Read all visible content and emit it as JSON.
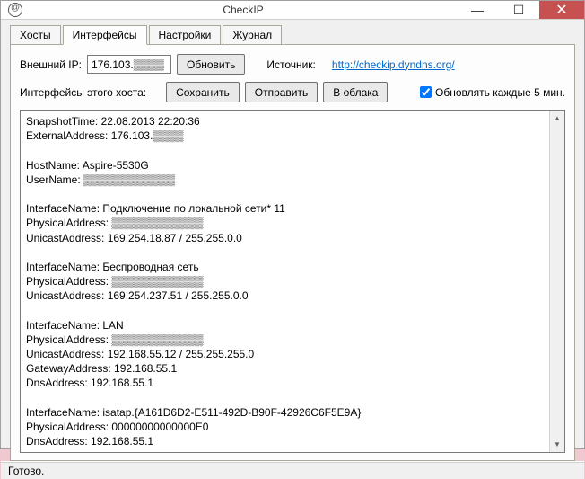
{
  "window": {
    "title": "CheckIP"
  },
  "tabs": {
    "items": [
      {
        "label": "Хосты"
      },
      {
        "label": "Интерфейсы"
      },
      {
        "label": "Настройки"
      },
      {
        "label": "Журнал"
      }
    ],
    "activeIndex": 1
  },
  "row1": {
    "ext_ip_label": "Внешний IP:",
    "ext_ip_value": "176.103.▒▒▒▒",
    "refresh_btn": "Обновить",
    "source_label": "Источник:",
    "source_link": "http://checkip.dyndns.org/"
  },
  "row2": {
    "host_interfaces_label": "Интерфейсы этого хоста:",
    "save_btn": "Сохранить",
    "send_btn": "Отправить",
    "cloud_btn": "В облака",
    "auto_refresh_label": "Обновлять каждые 5 мин.",
    "auto_refresh_checked": true
  },
  "output": {
    "lines": [
      "SnapshotTime: 22.08.2013 22:20:36",
      "ExternalAddress: 176.103.▒▒▒▒",
      "",
      "HostName: Aspire-5530G",
      "UserName: ▒▒▒▒▒▒▒▒▒▒▒▒",
      "",
      "InterfaceName: Подключение по локальной сети* 11",
      "PhysicalAddress: ▒▒▒▒▒▒▒▒▒▒▒▒",
      "UnicastAddress: 169.254.18.87 / 255.255.0.0",
      "",
      "InterfaceName: Беспроводная сеть",
      "PhysicalAddress: ▒▒▒▒▒▒▒▒▒▒▒▒",
      "UnicastAddress: 169.254.237.51 / 255.255.0.0",
      "",
      "InterfaceName: LAN",
      "PhysicalAddress: ▒▒▒▒▒▒▒▒▒▒▒▒",
      "UnicastAddress: 192.168.55.12 / 255.255.255.0",
      "GatewayAddress: 192.168.55.1",
      "DnsAddress: 192.168.55.1",
      "",
      "InterfaceName: isatap.{A161D6D2-E511-492D-B90F-42926C6F5E9A}",
      "PhysicalAddress: 00000000000000E0",
      "DnsAddress: 192.168.55.1"
    ]
  },
  "statusbar": {
    "text": "Готово."
  }
}
